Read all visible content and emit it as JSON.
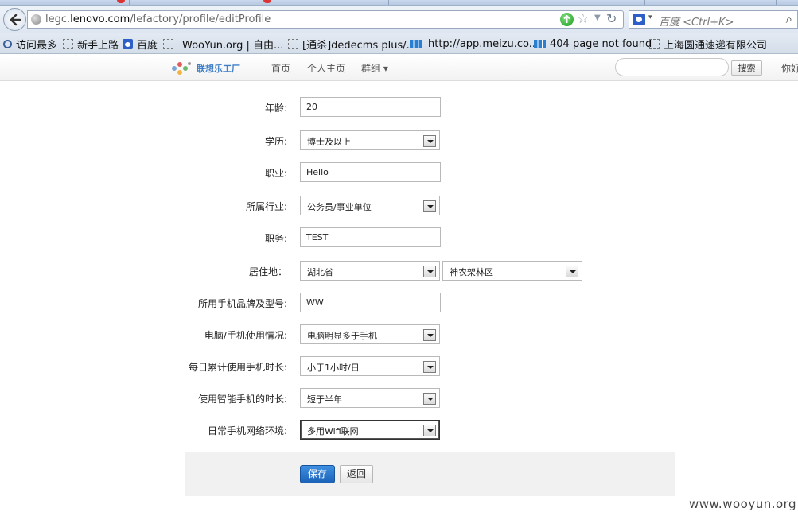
{
  "browser": {
    "url_prefix": "legc.",
    "url_domain": "lenovo.com",
    "url_path": "/lefactory/profile/editProfile",
    "search_placeholder": "百度 <Ctrl+K>",
    "bookmarks": [
      {
        "label": "访问最多",
        "icon": "magnifier-icon"
      },
      {
        "label": "新手上路",
        "icon": "page-icon"
      },
      {
        "label": "百度",
        "icon": "baidu-icon"
      },
      {
        "label": "WooYun.org | 自由...",
        "icon": "page-icon"
      },
      {
        "label": "[通杀]dedecms plus/...",
        "icon": "page-icon"
      },
      {
        "label": "http://app.meizu.co...",
        "icon": "meizu-icon"
      },
      {
        "label": "404 page not found",
        "icon": "meizu-icon"
      },
      {
        "label": "上海圆通速递有限公司",
        "icon": "page-icon"
      }
    ]
  },
  "site": {
    "logo_text": "联想乐工厂",
    "nav": [
      "首页",
      "个人主页",
      "群组 ▾"
    ],
    "search_button": "搜索",
    "greeting": "你好"
  },
  "form": {
    "fields": [
      {
        "label": "年龄:",
        "type": "text",
        "value": "20"
      },
      {
        "label": "学历:",
        "type": "select",
        "value": "博士及以上"
      },
      {
        "label": "职业:",
        "type": "text",
        "value": "Hello"
      },
      {
        "label": "所属行业:",
        "type": "select",
        "value": "公务员/事业单位"
      },
      {
        "label": "职务:",
        "type": "text",
        "value": "TEST"
      },
      {
        "label": "居住地：",
        "type": "select2",
        "value": "湖北省",
        "value2": "神农架林区"
      },
      {
        "label": "所用手机品牌及型号:",
        "type": "text",
        "value": "WW"
      },
      {
        "label": "电脑/手机使用情况:",
        "type": "select",
        "value": "电脑明显多于手机"
      },
      {
        "label": "每日累计使用手机时长:",
        "type": "select",
        "value": "小于1小时/日"
      },
      {
        "label": "使用智能手机的时长:",
        "type": "select",
        "value": "短于半年"
      },
      {
        "label": "日常手机网络环境:",
        "type": "select",
        "value": "多用Wifi联网"
      }
    ],
    "save_label": "保存",
    "back_label": "返回"
  },
  "watermark": "www.wooyun.org"
}
